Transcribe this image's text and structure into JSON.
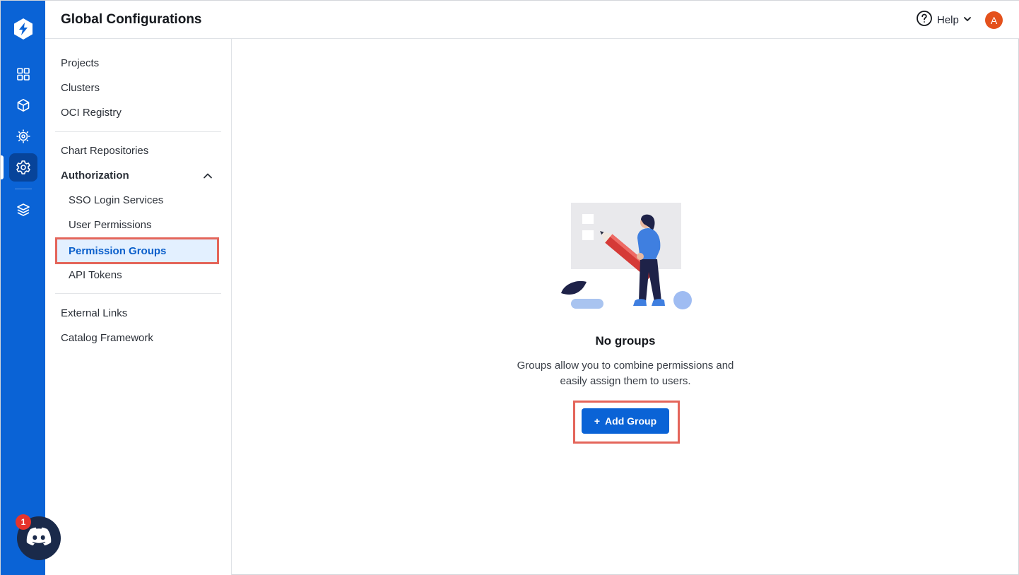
{
  "header": {
    "title": "Global Configurations",
    "help_label": "Help",
    "avatar_initial": "A"
  },
  "rail": {
    "icons": [
      "devtron-logo-icon",
      "apps-grid-icon",
      "cube-icon",
      "bug-gear-icon",
      "settings-gear-icon",
      "stack-layers-icon"
    ],
    "active": "settings-gear-icon",
    "brand_color": "#0a63d6"
  },
  "discord": {
    "badge_count": "1"
  },
  "sidebar": {
    "items": {
      "projects": "Projects",
      "clusters": "Clusters",
      "oci_registry": "OCI Registry",
      "chart_repositories": "Chart Repositories",
      "authorization": "Authorization",
      "sso_login": "SSO Login Services",
      "user_permissions": "User Permissions",
      "permission_groups": "Permission Groups",
      "api_tokens": "API Tokens",
      "external_links": "External Links",
      "catalog_framework": "Catalog Framework"
    },
    "active_item": "Permission Groups",
    "highlight_color": "#e4655a"
  },
  "empty_state": {
    "title": "No groups",
    "description": "Groups allow you to combine permissions and easily assign them to users.",
    "button_label": "Add Group",
    "button_icon": "+"
  }
}
